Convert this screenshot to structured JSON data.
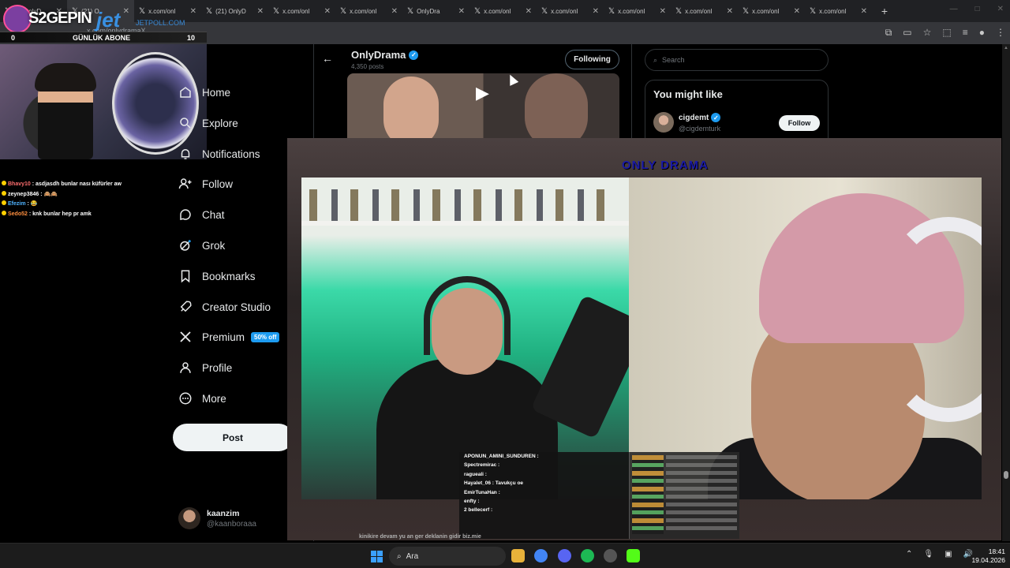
{
  "browser": {
    "tabs": [
      {
        "title": "(1) OnlyD",
        "icon": "x-icon"
      },
      {
        "title": "(21) O",
        "icon": "x-icon",
        "active": true
      },
      {
        "title": "x.com/onl",
        "icon": "x-icon"
      },
      {
        "title": "(21) OnlyD",
        "icon": "x-icon"
      },
      {
        "title": "x.com/onl",
        "icon": "x-icon"
      },
      {
        "title": "x.com/onl",
        "icon": "x-icon"
      },
      {
        "title": "OnlyDra",
        "icon": "x-icon"
      },
      {
        "title": "x.com/onl",
        "icon": "x-icon"
      },
      {
        "title": "x.com/onl",
        "icon": "x-icon"
      },
      {
        "title": "x.com/onl",
        "icon": "x-icon"
      },
      {
        "title": "x.com/onl",
        "icon": "x-icon"
      },
      {
        "title": "x.com/onl",
        "icon": "x-icon"
      },
      {
        "title": "x.com/onl",
        "icon": "x-icon"
      }
    ],
    "url": "x.com/onlydramaX"
  },
  "stream": {
    "streamer_name": "S2GEPIN",
    "sponsor": "jet",
    "sponsor_sub": "JETPOLL.COM",
    "sub_label": "GÜNLÜK ABONE",
    "sub_current": "0",
    "sub_goal": "10"
  },
  "chat": [
    {
      "user": "Bhavy10",
      "text": ": asdjasdh bunlar nası küfürler aw",
      "color": "u1"
    },
    {
      "user": "zeynep3846",
      "text": ": 🙈🙈",
      "color": "u2"
    },
    {
      "user": "Efezim",
      "text": ": 😂",
      "color": "u3"
    },
    {
      "user": "Sedo52",
      "text": ": knk bunlar hep pr amk",
      "color": "u4"
    }
  ],
  "nav": {
    "items": [
      {
        "label": "Home",
        "icon": "home-icon"
      },
      {
        "label": "Explore",
        "icon": "search-icon"
      },
      {
        "label": "Notifications",
        "icon": "bell-icon"
      },
      {
        "label": "Follow",
        "icon": "person-add-icon"
      },
      {
        "label": "Chat",
        "icon": "chat-icon"
      },
      {
        "label": "Grok",
        "icon": "grok-icon"
      },
      {
        "label": "Bookmarks",
        "icon": "bookmark-icon"
      },
      {
        "label": "Creator Studio",
        "icon": "rocket-icon"
      },
      {
        "label": "Premium",
        "icon": "x-logo-icon",
        "badge": "50% off"
      },
      {
        "label": "Profile",
        "icon": "person-icon"
      },
      {
        "label": "More",
        "icon": "more-icon"
      }
    ],
    "post_label": "Post"
  },
  "user": {
    "name": "kaanzim",
    "handle": "@kaanboraaa"
  },
  "profile": {
    "name": "OnlyDrama",
    "posts": "4,350 posts",
    "following_label": "Following"
  },
  "sidebar": {
    "search_placeholder": "Search",
    "might_title": "You might like",
    "suggestion": {
      "name": "cigdemt",
      "handle": "@cigdemturk",
      "follow_label": "Follow"
    }
  },
  "overlay": {
    "logo": "ONLY DRAMA",
    "chat": [
      "APONUN_AMINI_SUNDUREN :",
      "Spectremirac :",
      "ragueali :",
      "Hayalet_06 : Tavukçu oe",
      "EmirTunaHan :",
      "enfty :",
      "2 bellecerf :"
    ],
    "bottom_caption": "kinikire devam yu an ger deklanin gidir biz.mie"
  },
  "taskbar": {
    "search_label": "Ara",
    "time": "18:41",
    "date": "19.04.2026"
  },
  "colors": {
    "accent": "#1d9bf0",
    "background": "#000000",
    "text": "#e7e9ea",
    "muted": "#71767b"
  }
}
